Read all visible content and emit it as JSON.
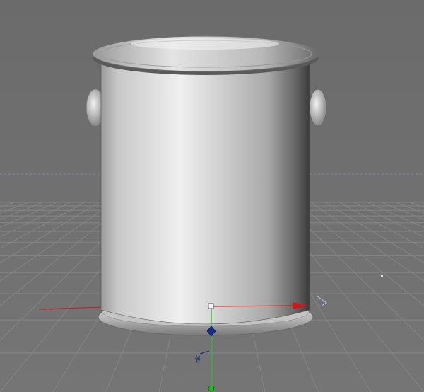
{
  "viewport": {
    "view_type": "perspective",
    "grid_visible": true,
    "colors": {
      "background_upper": "#6e6e6e",
      "background_lower": "#747474",
      "grid_line": "#858585",
      "horizon_line": "#7a86b0",
      "x_axis": "#d01818",
      "y_axis": "#18c018",
      "z_axis": "#2030a0",
      "object_surface": "#d8d8d8",
      "object_shadow": "#4a4a4a"
    }
  },
  "scene": {
    "object": {
      "type": "paint-can",
      "parts": [
        "can-body",
        "top-rim",
        "bottom-rim",
        "left-handle-lug",
        "right-handle-lug"
      ]
    },
    "gizmo": {
      "mode": "move",
      "axes": [
        "x",
        "y",
        "z"
      ],
      "label_text": "hk"
    }
  }
}
